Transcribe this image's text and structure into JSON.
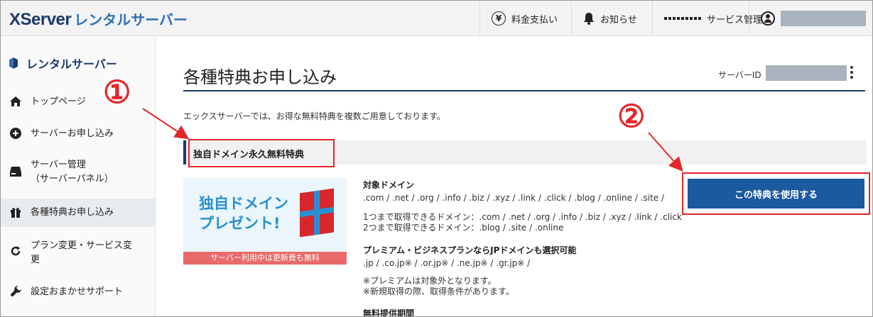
{
  "header": {
    "logo_main": "XServer",
    "logo_sub": "レンタルサーバー",
    "nav": [
      {
        "icon": "yen-icon",
        "label": "料金支払い"
      },
      {
        "icon": "bell-icon",
        "label": "お知らせ"
      },
      {
        "icon": "grid-icon",
        "label": "サービス管理"
      },
      {
        "icon": "user-icon",
        "label": ""
      }
    ]
  },
  "sidebar": {
    "title": "レンタルサーバー",
    "items": [
      {
        "icon": "home-icon",
        "label": "トップページ"
      },
      {
        "icon": "plus-circle-icon",
        "label": "サーバーお申し込み"
      },
      {
        "icon": "server-icon",
        "label": "サーバー管理",
        "sub": "（サーバーパネル）"
      },
      {
        "icon": "gift-icon",
        "label": "各種特典お申し込み",
        "active": true
      },
      {
        "icon": "refresh-icon",
        "label": "プラン変更・サービス変",
        "label2": "更"
      },
      {
        "icon": "wrench-icon",
        "label": "設定おまかせサポート"
      }
    ]
  },
  "main": {
    "title": "各種特典お申し込み",
    "server_id_label": "サーバーID",
    "intro": "エックスサーバーでは、お得な無料特典を複数ご用意しております。",
    "section_title": "独自ドメイン永久無料特典",
    "banner": {
      "line1": "独自ドメイン",
      "line2": "プレゼント!",
      "footer": "サーバー利用中は更新費も無料"
    },
    "domain_heading": "対象ドメイン",
    "domain_list": ".com / .net / .org / .info / .biz / .xyz / .link / .click / .blog / .online / .site /",
    "one_domain": "1つまで取得できるドメイン：.com / .net / .org / .info / .biz / .xyz / .link / .click",
    "two_domain": "2つまで取得できるドメイン：.blog / .site / .online",
    "premium_heading": "プレミアム・ビジネスプランならJPドメインも選択可能",
    "jp_list": ".jp / .co.jp※ / .or.jp※ / .ne.jp※ / .gr.jp※ /",
    "note1": "※プレミアムは対象外となります。",
    "note2": "※新規取得の際、取得条件があります。",
    "period_heading": "無料提供期間",
    "use_button": "この特典を使用する"
  },
  "annotations": {
    "marker1": "①",
    "marker2": "②",
    "color": "#e3262b"
  }
}
